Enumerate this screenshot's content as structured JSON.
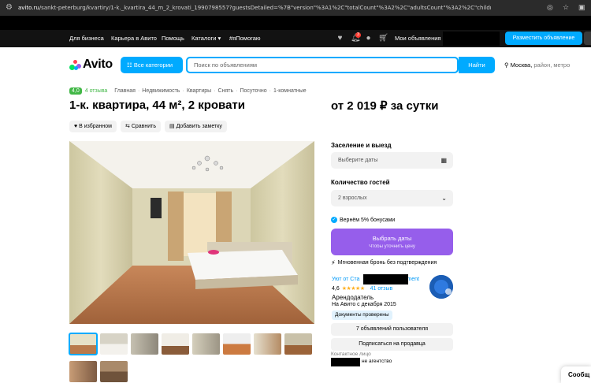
{
  "browser": {
    "url_host": "avito.ru",
    "url_path": "/sankt-peterburg/kvartiry/1-k._kvartira_44_m_2_krovati_1990798557?guestsDetailed=%7B\"version\"%3A1%2C\"totalCount\"%3A2%2C\"adultsCount\"%3A2%2C\"children\"%3A%5B%5D%7D"
  },
  "topnav": {
    "links": [
      "Для бизнеса",
      "Карьера в Авито",
      "Помощь",
      "Каталоги ▾",
      "#яПомогаю"
    ],
    "notif_count": "3",
    "my_ads": "Мои объявления",
    "place_ad": "Разместить объявление"
  },
  "header": {
    "logo_text": "Avito",
    "categories_btn": "Все категории",
    "search_placeholder": "Поиск по объявлениям",
    "find_btn": "Найти",
    "location_city": "Москва,",
    "location_rest": "район, метро"
  },
  "crumbs": {
    "rating": "4,0",
    "reviews": "4 отзыва",
    "items": [
      "Главная",
      "Недвижимость",
      "Квартиры",
      "Снять",
      "Посуточно",
      "1-комнатные"
    ]
  },
  "listing": {
    "title": "1-к. квартира, 44 м², 2 кровати",
    "price": "от 2 019 ₽ за сутки",
    "actions": [
      "В избранном",
      "Сравнить",
      "Добавить заметку"
    ]
  },
  "booking": {
    "dates_label": "Заселение и выезд",
    "dates_placeholder": "Выберите даты",
    "guests_label": "Количество гостей",
    "guests_value": "2 взрослых",
    "bonus": "Вернём 5% бонусами",
    "choose_btn": "Выбрать даты",
    "choose_sub": "Чтобы уточнить цену",
    "instant": "Мгновенная бронь без подтверждения"
  },
  "host": {
    "link_start": "Уют от Ста",
    "link_end": "ment",
    "rating": "4,6",
    "stars": "★★★★★",
    "reviews": "41 отзыв",
    "role": "Арендодатель",
    "since": "На Авито с декабря 2015",
    "docs": "Документы проверены",
    "btn_ads": "7 объявлений пользователя",
    "btn_sub": "Подписаться на продавца",
    "contact_label": "Контактное лицо",
    "contact_sub": "не агентство"
  },
  "chat": {
    "label": "Сообщ"
  }
}
